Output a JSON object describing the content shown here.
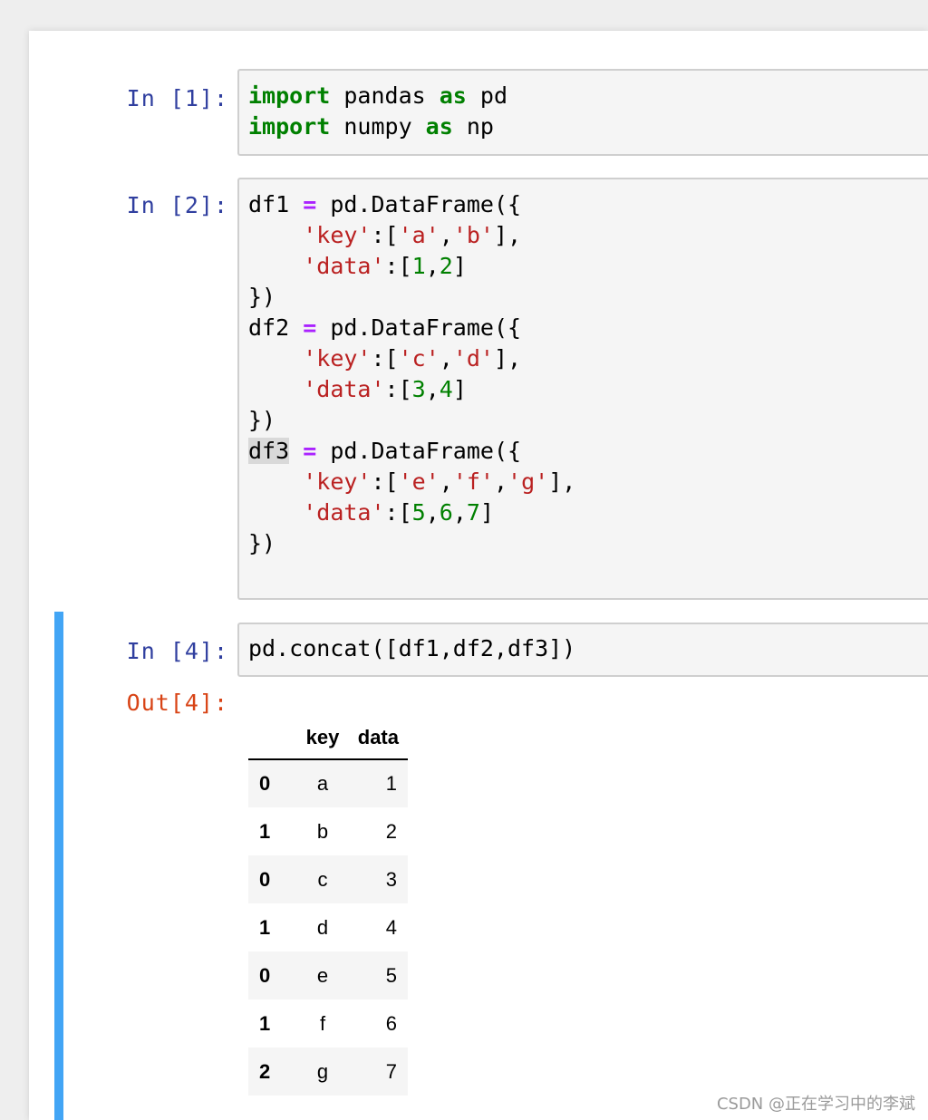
{
  "cells": [
    {
      "prompt": "In [1]:",
      "lines": [
        [
          [
            "kw",
            "import"
          ],
          [
            "t",
            " pandas "
          ],
          [
            "kw",
            "as"
          ],
          [
            "t",
            " pd"
          ]
        ],
        [
          [
            "kw",
            "import"
          ],
          [
            "t",
            " numpy "
          ],
          [
            "kw",
            "as"
          ],
          [
            "t",
            " np"
          ]
        ]
      ]
    },
    {
      "prompt": "In [2]:",
      "lines": [
        [
          [
            "t",
            "df1 "
          ],
          [
            "op",
            "="
          ],
          [
            "t",
            " pd.DataFrame({"
          ]
        ],
        [
          [
            "t",
            "    "
          ],
          [
            "str",
            "'key'"
          ],
          [
            "t",
            ":["
          ],
          [
            "str",
            "'a'"
          ],
          [
            "t",
            ","
          ],
          [
            "str",
            "'b'"
          ],
          [
            "t",
            "],"
          ]
        ],
        [
          [
            "t",
            "    "
          ],
          [
            "str",
            "'data'"
          ],
          [
            "t",
            ":["
          ],
          [
            "num",
            "1"
          ],
          [
            "t",
            ","
          ],
          [
            "num",
            "2"
          ],
          [
            "t",
            "]"
          ]
        ],
        [
          [
            "t",
            "})"
          ]
        ],
        [
          [
            "t",
            "df2 "
          ],
          [
            "op",
            "="
          ],
          [
            "t",
            " pd.DataFrame({"
          ]
        ],
        [
          [
            "t",
            "    "
          ],
          [
            "str",
            "'key'"
          ],
          [
            "t",
            ":["
          ],
          [
            "str",
            "'c'"
          ],
          [
            "t",
            ","
          ],
          [
            "str",
            "'d'"
          ],
          [
            "t",
            "],"
          ]
        ],
        [
          [
            "t",
            "    "
          ],
          [
            "str",
            "'data'"
          ],
          [
            "t",
            ":["
          ],
          [
            "num",
            "3"
          ],
          [
            "t",
            ","
          ],
          [
            "num",
            "4"
          ],
          [
            "t",
            "]"
          ]
        ],
        [
          [
            "t",
            "})"
          ]
        ],
        [
          [
            "hl",
            "df3"
          ],
          [
            "t",
            " "
          ],
          [
            "op",
            "="
          ],
          [
            "t",
            " pd.DataFrame({"
          ]
        ],
        [
          [
            "t",
            "    "
          ],
          [
            "str",
            "'key'"
          ],
          [
            "t",
            ":["
          ],
          [
            "str",
            "'e'"
          ],
          [
            "t",
            ","
          ],
          [
            "str",
            "'f'"
          ],
          [
            "t",
            ","
          ],
          [
            "str",
            "'g'"
          ],
          [
            "t",
            "],"
          ]
        ],
        [
          [
            "t",
            "    "
          ],
          [
            "str",
            "'data'"
          ],
          [
            "t",
            ":["
          ],
          [
            "num",
            "5"
          ],
          [
            "t",
            ","
          ],
          [
            "num",
            "6"
          ],
          [
            "t",
            ","
          ],
          [
            "num",
            "7"
          ],
          [
            "t",
            "]"
          ]
        ],
        [
          [
            "t",
            "})"
          ]
        ]
      ]
    },
    {
      "prompt": "In [4]:",
      "out_prompt": "Out[4]:",
      "lines": [
        [
          [
            "t",
            "pd.concat([df1,df2,df3])"
          ]
        ]
      ]
    }
  ],
  "output_table": {
    "columns": [
      "key",
      "data"
    ],
    "rows": [
      {
        "index": "0",
        "key": "a",
        "data": "1"
      },
      {
        "index": "1",
        "key": "b",
        "data": "2"
      },
      {
        "index": "0",
        "key": "c",
        "data": "3"
      },
      {
        "index": "1",
        "key": "d",
        "data": "4"
      },
      {
        "index": "0",
        "key": "e",
        "data": "5"
      },
      {
        "index": "1",
        "key": "f",
        "data": "6"
      },
      {
        "index": "2",
        "key": "g",
        "data": "7"
      }
    ]
  },
  "watermark": "CSDN @正在学习中的李斌",
  "colors": {
    "in_prompt": "#303f9f",
    "out_prompt": "#d84315",
    "keyword": "#008000",
    "operator": "#aa22ff",
    "string": "#ba2121",
    "number": "#008000",
    "selected_bar": "#42a5f5"
  }
}
